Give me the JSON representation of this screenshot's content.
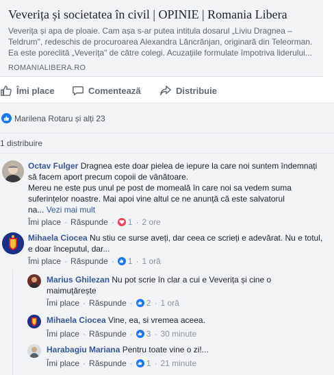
{
  "link": {
    "title": "Veverița și societatea în civil | OPINIE | Romania Libera",
    "desc_line1": "Veverița și apa de ploaie. Cam așa s-ar putea intitula dosarul „Liviu Dragnea –",
    "desc_line2": "Teldrum\", redeschis de procuroarea Alexandra Lăncrănjan, originară din Teleorman.",
    "desc_line3": "Ea este poreclită „Veverița\" de către colegi. Acuzațiile formulate împotriva liderului...",
    "domain": "ROMANIALIBERA.RO"
  },
  "actions": {
    "like": "Îmi place",
    "comment": "Comentează",
    "share": "Distribuie"
  },
  "reactions_summary": "Marilena Rotaru și alți 23",
  "shares_count": "1 distribuire",
  "colors": {
    "link": "#385898",
    "like_blue": "#1877f2",
    "heart_red": "#f33e58",
    "muted": "#90949c"
  },
  "comments": [
    {
      "author": "Octav Fulger",
      "line1": "Dragnea este doar pielea de iepure la care noi suntem îndemnați",
      "line2": "să facem aport precum copoii de vânătoare.",
      "line3": "Mereu ne este pus unul pe post de momeală în care noi sa vedem suma",
      "line4": "suferințelor noastre. Mai apoi vine altul ce ne anunță că este salvatorul",
      "line5": "na...",
      "more": "Vezi mai mult",
      "like": "Îmi place",
      "reply": "Răspunde",
      "reaction_icon": "heart-icon",
      "reaction_count": "1",
      "time": "2 ore"
    },
    {
      "author": "Mihaela Ciocea",
      "line1": "Nu stiu ce surse aveți, dar ceea ce scrieți e adevărat. Nu e totul,",
      "line2": "e doar începutul, dar...",
      "like": "Îmi place",
      "reply": "Răspunde",
      "reaction_icon": "thumbs-up-icon",
      "reaction_count": "1",
      "time": "1 oră"
    }
  ],
  "replies": [
    {
      "author": "Marius Ghilezan",
      "line1": "Nu pot scrie în clar a cui e Veverița și cine o",
      "line2": "maimuțărește",
      "like": "Îmi place",
      "reply": "Răspunde",
      "reaction_icon": "thumbs-up-icon",
      "reaction_count": "2",
      "time": "1 oră"
    },
    {
      "author": "Mihaela Ciocea",
      "line1": "Vine, ea, si vremea aceea.",
      "like": "Îmi place",
      "reply": "Răspunde",
      "reaction_icon": "thumbs-up-icon",
      "reaction_count": "3",
      "time": "30 minute"
    },
    {
      "author": "Harabagiu Mariana",
      "line1": "Pentru toate vine o zi!...",
      "like": "Îmi place",
      "reply": "Răspunde",
      "reaction_icon": "thumbs-up-icon",
      "reaction_count": "1",
      "time": "21 minute"
    }
  ]
}
